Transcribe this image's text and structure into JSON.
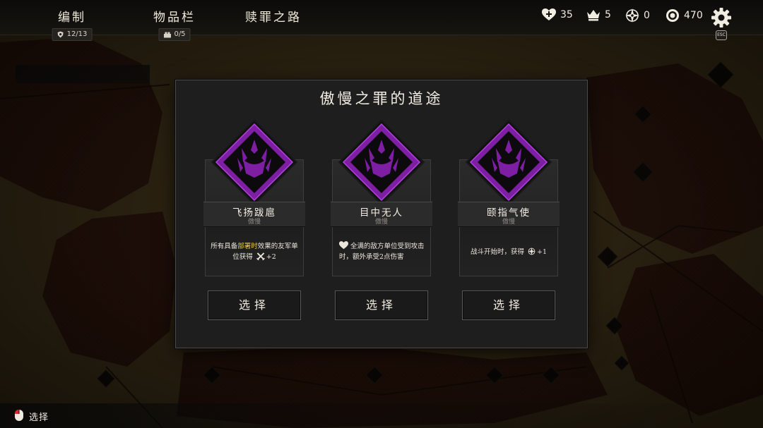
{
  "nav": {
    "tabs": [
      {
        "label": "编制",
        "badge": "12/13",
        "badge_icon": "shield-icon"
      },
      {
        "label": "物品栏",
        "badge": "0/5",
        "badge_icon": "crate-icon"
      },
      {
        "label": "赎罪之路"
      }
    ]
  },
  "stats": {
    "health": "35",
    "crowns": "5",
    "compass": "0",
    "coins": "470"
  },
  "esc_label": "ESC",
  "modal": {
    "title": "傲慢之罪的道途",
    "cards": [
      {
        "name": "飞扬跋扈",
        "sin": "傲慢",
        "desc_pre": "所有具备",
        "desc_highlight": "部署时",
        "desc_post": "效果的友军单位获得",
        "desc_value": "+2",
        "icon": "crossed-swords-icon",
        "button": "选择"
      },
      {
        "name": "目中无人",
        "sin": "傲慢",
        "desc_pre": "全满的敌方单位受到攻击时，额外承受2点伤害",
        "icon": "heart-icon",
        "button": "选择"
      },
      {
        "name": "颐指气使",
        "sin": "傲慢",
        "desc_pre": "战斗开始时，获得",
        "desc_value": "+1",
        "icon": "compass-icon",
        "button": "选择"
      }
    ]
  },
  "bottom_hint": {
    "label": "选择",
    "icon": "mouse-icon"
  },
  "colors": {
    "accent_purple": "#8a1fb0",
    "highlight_yellow": "#e8c94a",
    "panel": "#1e1e1f"
  }
}
